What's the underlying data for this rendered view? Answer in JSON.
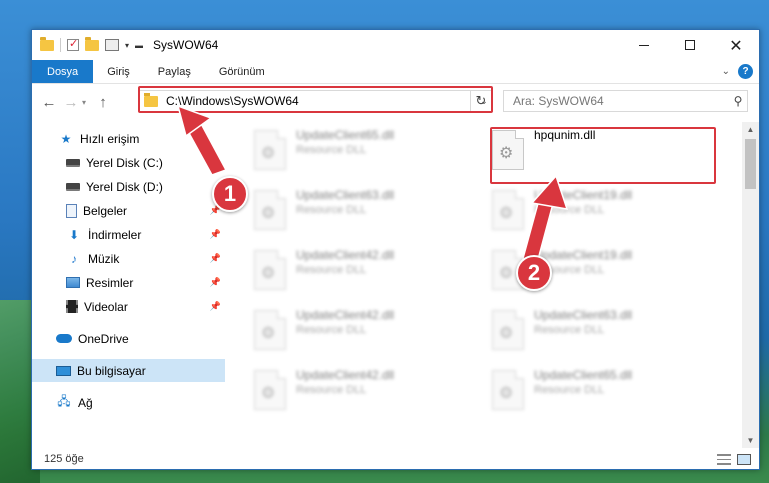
{
  "window": {
    "title": "SysWOW64",
    "controls": {
      "minimize": "minimize-icon",
      "maximize": "maximize-icon",
      "close": "close-icon"
    }
  },
  "ribbon": {
    "tabs": [
      {
        "label": "Dosya",
        "active": true
      },
      {
        "label": "Giriş"
      },
      {
        "label": "Paylaş"
      },
      {
        "label": "Görünüm"
      }
    ],
    "help": "?"
  },
  "nav": {
    "address": "C:\\Windows\\SysWOW64",
    "search_placeholder": "Ara: SysWOW64"
  },
  "sidebar": {
    "items": [
      {
        "label": "Hızlı erişim",
        "icon": "star-icon"
      },
      {
        "label": "Yerel Disk (C:)",
        "icon": "disk-icon",
        "pinned": true
      },
      {
        "label": "Yerel Disk (D:)",
        "icon": "disk-icon",
        "pinned": true
      },
      {
        "label": "Belgeler",
        "icon": "documents-icon",
        "pinned": true
      },
      {
        "label": "İndirmeler",
        "icon": "download-icon",
        "pinned": true
      },
      {
        "label": "Müzik",
        "icon": "music-icon",
        "pinned": true
      },
      {
        "label": "Resimler",
        "icon": "pictures-icon",
        "pinned": true
      },
      {
        "label": "Videolar",
        "icon": "videos-icon",
        "pinned": true
      },
      {
        "label": "OneDrive",
        "icon": "onedrive-icon"
      },
      {
        "label": "Bu bilgisayar",
        "icon": "computer-icon",
        "selected": true
      },
      {
        "label": "Ağ",
        "icon": "network-icon"
      }
    ]
  },
  "files": {
    "highlighted": {
      "name": "hpqunim.dll",
      "type": ""
    },
    "left_column": [
      {
        "name": "UpdateClient65.dll",
        "type": "Resource DLL"
      },
      {
        "name": "UpdateClient63.dll",
        "type": "Resource DLL"
      },
      {
        "name": "UpdateClient42.dll",
        "type": "Resource DLL"
      },
      {
        "name": "UpdateClient42.dll",
        "type": "Resource DLL"
      },
      {
        "name": "UpdateClient42.dll",
        "type": "Resource DLL"
      }
    ],
    "right_column": [
      {
        "name": "UpdateClient19.dll",
        "type": "Resource DLL"
      },
      {
        "name": "UpdateClient19.dll",
        "type": "Resource DLL"
      },
      {
        "name": "UpdateClient63.dll",
        "type": "Resource DLL"
      },
      {
        "name": "UpdateClient65.dll",
        "type": "Resource DLL"
      }
    ]
  },
  "status": {
    "count": "125 öğe"
  },
  "callouts": {
    "one": "1",
    "two": "2"
  },
  "colors": {
    "accent": "#1979ca",
    "highlight_red": "#d9363e",
    "selected_bg": "#cce4f7"
  }
}
